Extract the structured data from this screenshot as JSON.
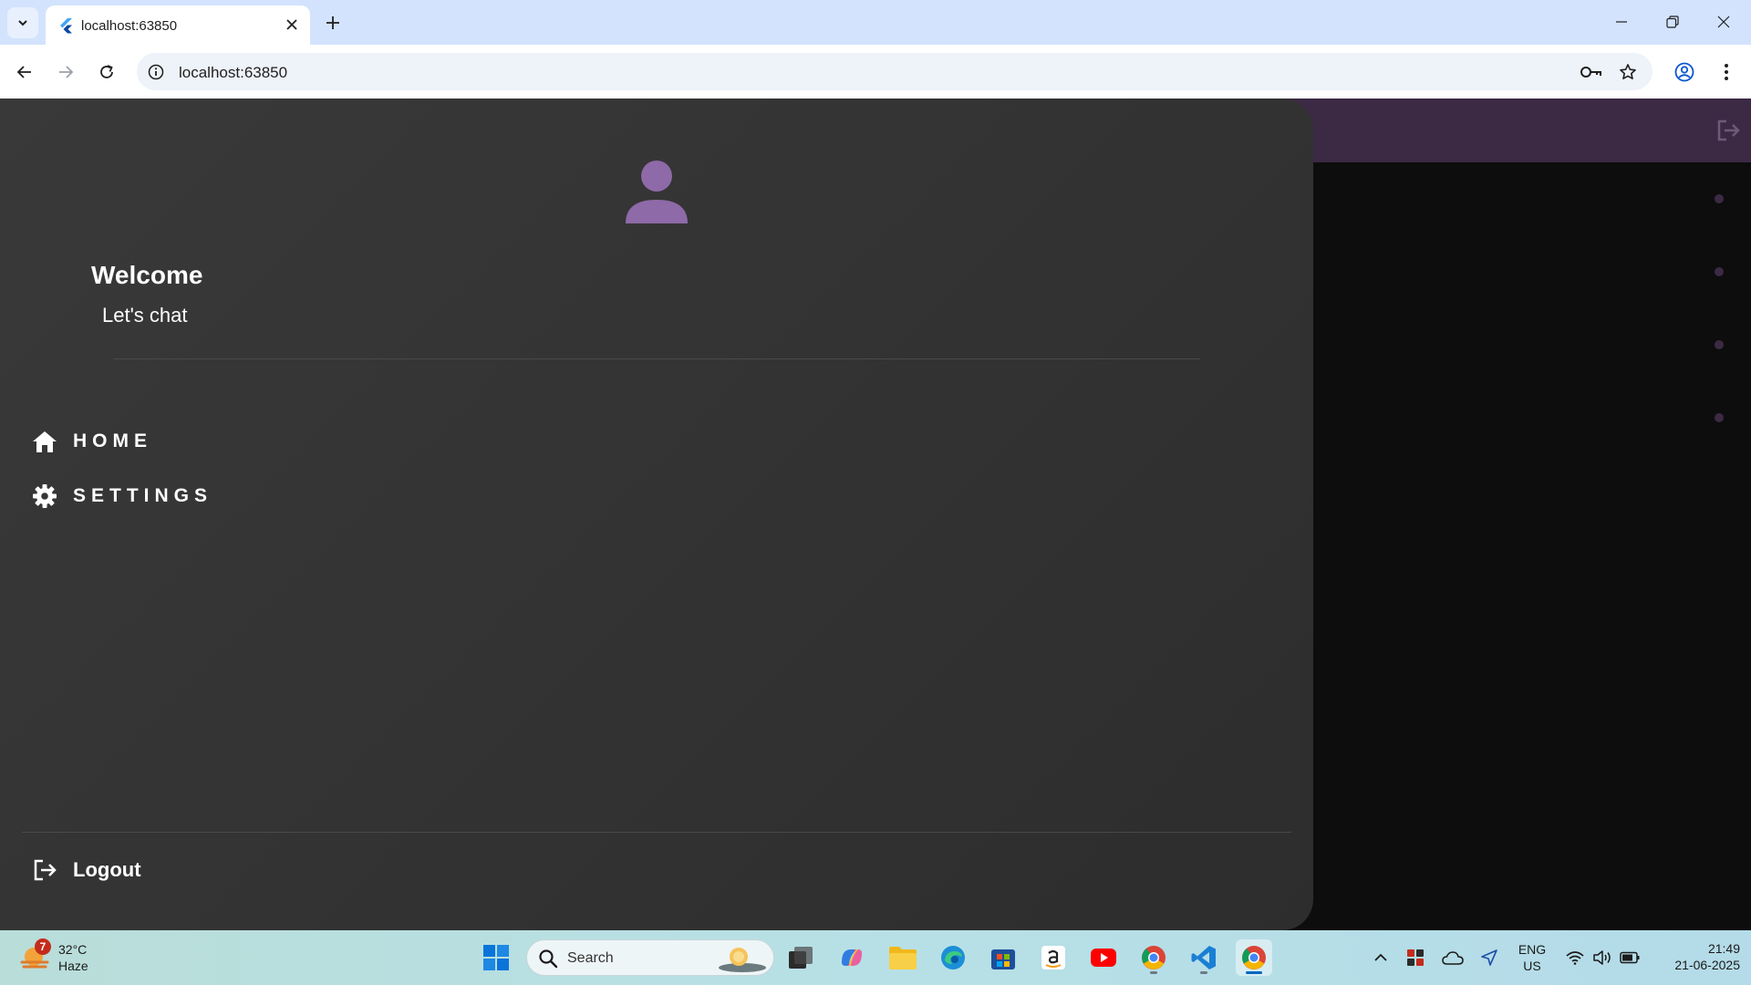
{
  "browser": {
    "tab_title": "localhost:63850",
    "url": "localhost:63850"
  },
  "drawer": {
    "welcome": "Welcome",
    "subtitle": "Let's chat",
    "nav_items": [
      {
        "label": "HOME",
        "icon": "home-icon"
      },
      {
        "label": "SETTINGS",
        "icon": "gear-icon"
      }
    ],
    "logout_label": "Logout"
  },
  "colors": {
    "accent_purple": "#8e6aa8",
    "appbar_bg": "#3c2a45",
    "drawer_bg": "#333333"
  },
  "taskbar": {
    "weather_badge": "7",
    "temperature": "32°C",
    "condition": "Haze",
    "search_placeholder": "Search",
    "lang_line1": "ENG",
    "lang_line2": "US",
    "time": "21:49",
    "date": "21-06-2025"
  }
}
